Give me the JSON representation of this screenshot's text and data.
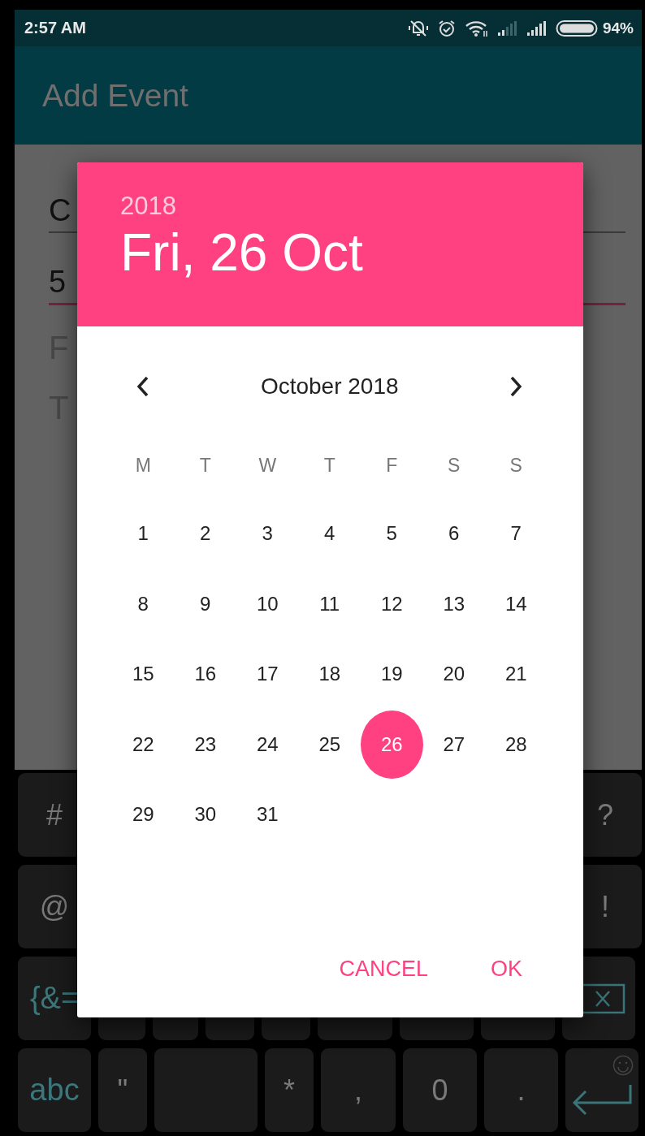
{
  "status_bar": {
    "time": "2:57 AM",
    "battery": "94%"
  },
  "app_bar": {
    "title": "Add Event"
  },
  "form": {
    "fields": [
      {
        "value": "C",
        "focused": false
      },
      {
        "value": "5",
        "focused": true
      }
    ],
    "labels": [
      "F",
      "T"
    ]
  },
  "date_picker": {
    "year": "2018",
    "date": "Fri, 26 Oct",
    "month": "October 2018",
    "weekdays": [
      "M",
      "T",
      "W",
      "T",
      "F",
      "S",
      "S"
    ],
    "days": [
      {
        "label": "1",
        "selected": false
      },
      {
        "label": "2",
        "selected": false
      },
      {
        "label": "3",
        "selected": false
      },
      {
        "label": "4",
        "selected": false
      },
      {
        "label": "5",
        "selected": false
      },
      {
        "label": "6",
        "selected": false
      },
      {
        "label": "7",
        "selected": false
      },
      {
        "label": "8",
        "selected": false
      },
      {
        "label": "9",
        "selected": false
      },
      {
        "label": "10",
        "selected": false
      },
      {
        "label": "11",
        "selected": false
      },
      {
        "label": "12",
        "selected": false
      },
      {
        "label": "13",
        "selected": false
      },
      {
        "label": "14",
        "selected": false
      },
      {
        "label": "15",
        "selected": false
      },
      {
        "label": "16",
        "selected": false
      },
      {
        "label": "17",
        "selected": false
      },
      {
        "label": "18",
        "selected": false
      },
      {
        "label": "19",
        "selected": false
      },
      {
        "label": "20",
        "selected": false
      },
      {
        "label": "21",
        "selected": false
      },
      {
        "label": "22",
        "selected": false
      },
      {
        "label": "23",
        "selected": false
      },
      {
        "label": "24",
        "selected": false
      },
      {
        "label": "25",
        "selected": false
      },
      {
        "label": "26",
        "selected": true
      },
      {
        "label": "27",
        "selected": false
      },
      {
        "label": "28",
        "selected": false
      },
      {
        "label": "29",
        "selected": false
      },
      {
        "label": "30",
        "selected": false
      },
      {
        "label": "31",
        "selected": false
      }
    ],
    "buttons": [
      "CANCEL",
      "OK"
    ]
  },
  "keyboard": {
    "rows": [
      [
        {
          "kind": "char",
          "label": "#"
        },
        {
          "kind": "char",
          "label": "?"
        }
      ],
      [
        {
          "kind": "char",
          "label": "@"
        },
        {
          "kind": "char",
          "label": "!"
        }
      ],
      [
        {
          "kind": "mode",
          "label": "{&="
        },
        {
          "kind": "blank"
        },
        {
          "kind": "blank"
        },
        {
          "kind": "blank"
        },
        {
          "kind": "blank"
        },
        {
          "kind": "blank"
        },
        {
          "kind": "blank"
        },
        {
          "kind": "blank"
        },
        {
          "kind": "backspace"
        }
      ],
      [
        {
          "kind": "mode",
          "label": "abc"
        },
        {
          "kind": "char",
          "label": "\""
        },
        {
          "kind": "space"
        },
        {
          "kind": "char",
          "label": "*"
        },
        {
          "kind": "char",
          "label": ","
        },
        {
          "kind": "char",
          "label": "0"
        },
        {
          "kind": "char",
          "label": "."
        },
        {
          "kind": "enter"
        }
      ]
    ]
  }
}
